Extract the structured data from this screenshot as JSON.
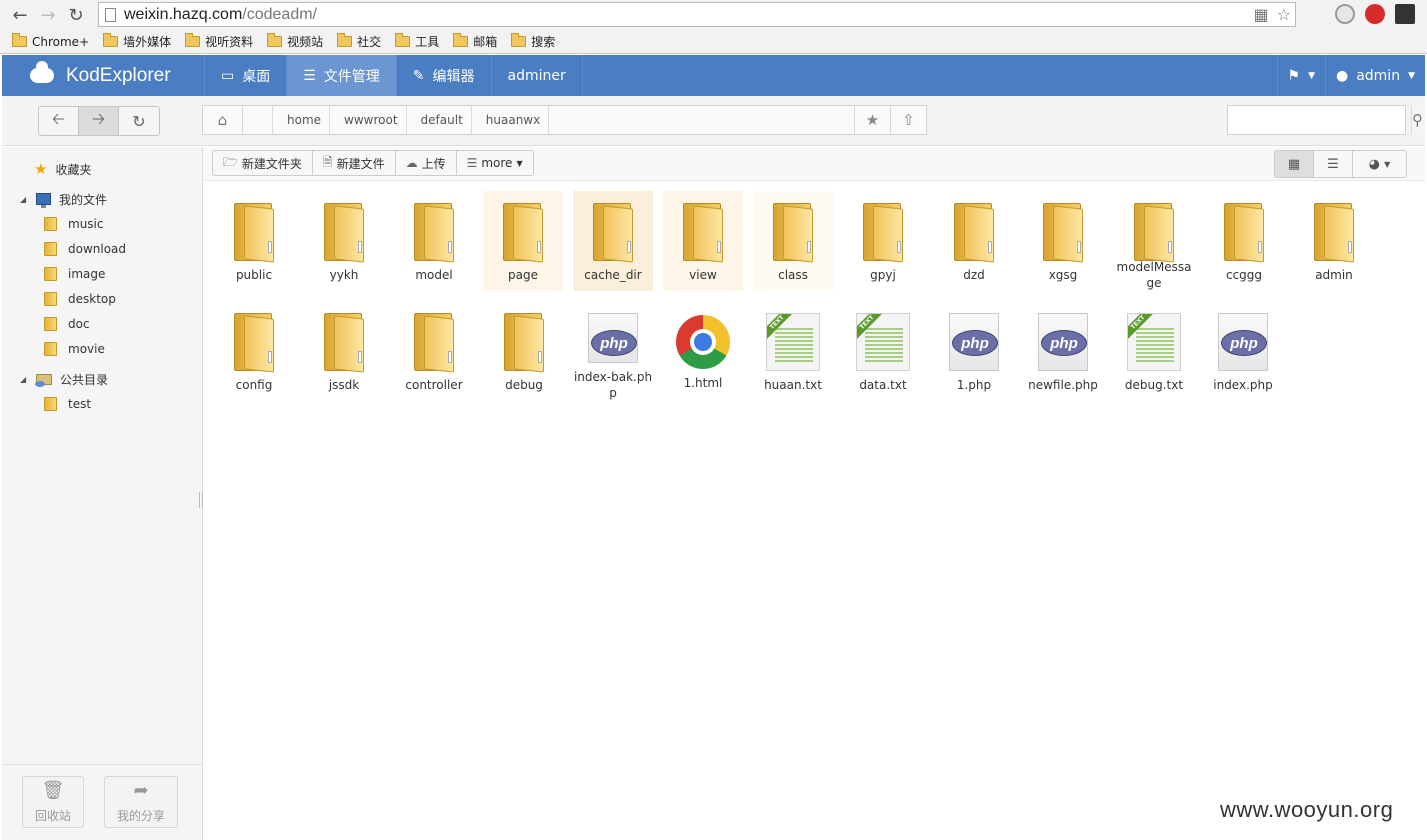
{
  "browser": {
    "url_host": "weixin.hazq.com",
    "url_path": "/codeadm/",
    "bookmarks": [
      "Chrome+",
      "墙外媒体",
      "视听资料",
      "视频站",
      "社交",
      "工具",
      "邮箱",
      "搜索"
    ]
  },
  "app": {
    "title": "KodExplorer",
    "nav": [
      "桌面",
      "文件管理",
      "编辑器",
      "adminer"
    ],
    "user": "admin"
  },
  "path": {
    "crumbs": [
      "home",
      "wwwroot",
      "default",
      "huaanwx"
    ]
  },
  "search": {
    "placeholder": ""
  },
  "toolbar": {
    "new_folder": "新建文件夹",
    "new_file": "新建文件",
    "upload": "上传",
    "more": "more"
  },
  "sidebar": {
    "favorites": "收藏夹",
    "my_files": "我的文件",
    "my_children": [
      "music",
      "download",
      "image",
      "desktop",
      "doc",
      "movie"
    ],
    "public": "公共目录",
    "public_children": [
      "test"
    ],
    "recycle": "回收站",
    "share": "我的分享"
  },
  "files_row1": [
    "public",
    "yykh",
    "model",
    "page",
    "cache_dir",
    "view",
    "class",
    "gpyj",
    "dzd",
    "xgsg",
    "modelMessage",
    "ccggg",
    "admin"
  ],
  "files_row2": [
    "config",
    "jssdk",
    "controller",
    "debug",
    "index-bak.php",
    "1.html",
    "huaan.txt",
    "data.txt",
    "1.php",
    "newfile.php",
    "debug.txt",
    "index.php"
  ],
  "icon_labels": {
    "php": "php",
    "text": "TEXT"
  },
  "watermark": "www.wooyun.org"
}
